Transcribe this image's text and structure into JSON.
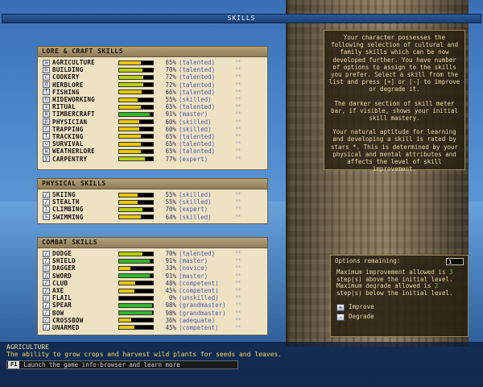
{
  "window": {
    "title": "SKILLS"
  },
  "panels": [
    {
      "title": "LORE & CRAFT SKILLS",
      "skills": [
        {
          "key": "a",
          "name": "AGRICULTURE",
          "value": 65,
          "pct": "65%",
          "level": "(talented)",
          "stars": "**"
        },
        {
          "key": "b",
          "name": "BUILDING",
          "value": 70,
          "pct": "70%",
          "level": "(talented)",
          "stars": "**"
        },
        {
          "key": "c",
          "name": "COOKERY",
          "value": 72,
          "pct": "72%",
          "level": "(talented)",
          "stars": "**"
        },
        {
          "key": "d",
          "name": "HERBLORE",
          "value": 72,
          "pct": "72%",
          "level": "(talented)",
          "stars": "**"
        },
        {
          "key": "f",
          "name": "FISHING",
          "value": 66,
          "pct": "66%",
          "level": "(talented)",
          "stars": "**"
        },
        {
          "key": "h",
          "name": "HIDEWORKING",
          "value": 55,
          "pct": "55%",
          "level": "(skilled)",
          "stars": "**"
        },
        {
          "key": "i",
          "name": "RITUAL",
          "value": 65,
          "pct": "65%",
          "level": "(talented)",
          "stars": "**"
        },
        {
          "key": "m",
          "name": "TIMBERCRAFT",
          "value": 91,
          "pct": "91%",
          "level": "(master)",
          "stars": "**"
        },
        {
          "key": "p",
          "name": "PHYSICIAN",
          "value": 60,
          "pct": "60%",
          "level": "(skilled)",
          "stars": "**"
        },
        {
          "key": "r",
          "name": "TRAPPING",
          "value": 60,
          "pct": "60%",
          "level": "(skilled)",
          "stars": "**"
        },
        {
          "key": "t",
          "name": "TRACKING",
          "value": 65,
          "pct": "65%",
          "level": "(talented)",
          "stars": "**"
        },
        {
          "key": "v",
          "name": "SURVIVAL",
          "value": 65,
          "pct": "65%",
          "level": "(talented)",
          "stars": "**"
        },
        {
          "key": "w",
          "name": "WEATHERLORE",
          "value": 65,
          "pct": "65%",
          "level": "(talented)",
          "stars": "**"
        },
        {
          "key": "y",
          "name": "CARPENTRY",
          "value": 77,
          "pct": "77%",
          "level": "(expert)",
          "stars": "**"
        }
      ]
    },
    {
      "title": "PHYSICAL SKILLS",
      "skills": [
        {
          "key": "/",
          "name": "SKIING",
          "value": 55,
          "pct": "55%",
          "level": "(skilled)",
          "stars": "**"
        },
        {
          "key": "/",
          "name": "STEALTH",
          "value": 55,
          "pct": "55%",
          "level": "(skilled)",
          "stars": "**"
        },
        {
          "key": "l",
          "name": "CLIMBING",
          "value": 70,
          "pct": "70%",
          "level": "(expert)",
          "stars": "**"
        },
        {
          "key": "s",
          "name": "SWIMMING",
          "value": 64,
          "pct": "64%",
          "level": "(skilled)",
          "stars": "**"
        }
      ]
    },
    {
      "title": "COMBAT SKILLS",
      "skills": [
        {
          "key": "/",
          "name": "DODGE",
          "value": 70,
          "pct": "70%",
          "level": "(talented)",
          "stars": "**"
        },
        {
          "key": "/",
          "name": "SHIELD",
          "value": 91,
          "pct": "91%",
          "level": "(master)",
          "stars": "**"
        },
        {
          "key": "/",
          "name": "DAGGER",
          "value": 33,
          "pct": "33%",
          "level": "(novice)",
          "stars": "**"
        },
        {
          "key": "/",
          "name": "SWORD",
          "value": 91,
          "pct": "91%",
          "level": "(master)",
          "stars": "**"
        },
        {
          "key": "/",
          "name": "CLUB",
          "value": 48,
          "pct": "48%",
          "level": "(competent)",
          "stars": "**"
        },
        {
          "key": "/",
          "name": "AXE",
          "value": 45,
          "pct": "45%",
          "level": "(competent)",
          "stars": "**"
        },
        {
          "key": "/",
          "name": "FLAIL",
          "value": 0,
          "pct": "0%",
          "level": "(unskilled)",
          "stars": "**"
        },
        {
          "key": "/",
          "name": "SPEAR",
          "value": 98,
          "pct": "98%",
          "level": "(grandmaster)",
          "stars": "**"
        },
        {
          "key": "/",
          "name": "BOW",
          "value": 98,
          "pct": "98%",
          "level": "(grandmaster)",
          "stars": "**"
        },
        {
          "key": "/",
          "name": "CROSSBOW",
          "value": 36,
          "pct": "36%",
          "level": "(adequate)",
          "stars": "**"
        },
        {
          "key": "/",
          "name": "UNARMED",
          "value": 45,
          "pct": "45%",
          "level": "(competent)",
          "stars": "**"
        }
      ]
    }
  ],
  "info": {
    "p1": "Your character possesses the following selection of cultural and family skills which can be now developed further. You have number of options to assign to the skills you prefer. Select a skill from the list and press [+] or [-] to improve or degrade it.",
    "p2": "The darker section of skill meter bar, if visible, shows your initial skill mastery.",
    "p3": "Your natural aptitude for learning and developing a skill is rated by stars *. This is determined by your physical and mental attributes and affects the level of skill improvement."
  },
  "options": {
    "label": "Options remaining:",
    "count": "1",
    "line1a": "Maximum improvement allowed is ",
    "improve_steps": "3",
    "line1b": " step(s) above the initial level.",
    "line2a": "Maximum degrade allowed is ",
    "degrade_steps": "2",
    "line2b": " step(s) below the initial level.",
    "improve_label": "Improve",
    "degrade_label": "Degrade",
    "plus": "+",
    "minus": "-"
  },
  "description": {
    "title": "AGRICULTURE",
    "text": "The ability to grow crops and harvest wild plants for seeds and leaves."
  },
  "help": {
    "key": "F1",
    "text": "Launch the game info-browser and learn more"
  },
  "colors": {
    "bar_low": "#e8c800",
    "bar_mid": "#b8d000",
    "bar_high": "#2fb82a",
    "initial": "#2a7a1c"
  }
}
